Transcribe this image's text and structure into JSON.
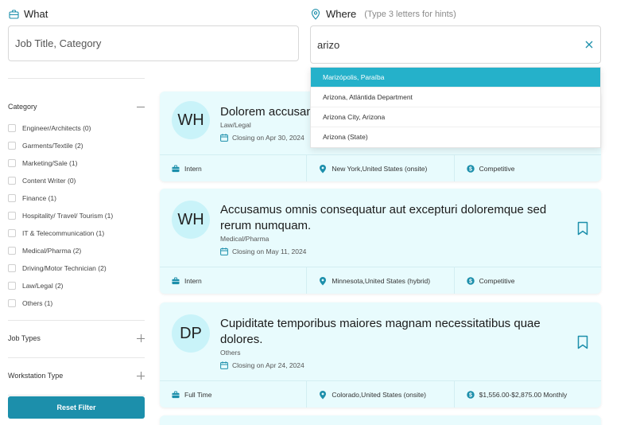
{
  "search": {
    "what_label": "What",
    "what_placeholder": "Job Title, Category",
    "where_label": "Where",
    "where_hint": "(Type 3 letters for hints)",
    "where_value": "arizo",
    "suggestions": [
      "Marizópolis, Paraíba",
      "Arizona, Atlántida Department",
      "Arizona City, Arizona",
      "Arizona (State)"
    ]
  },
  "sidebar": {
    "category_title": "Category",
    "categories": [
      "Engineer/Architects (0)",
      "Garments/Textile (2)",
      "Marketing/Sale (1)",
      "Content Writer (0)",
      "Finance (1)",
      "Hospitality/ Travel/ Tourism (1)",
      "IT & Telecommunication (1)",
      "Medical/Pharma (2)",
      "Driving/Motor Technician (2)",
      "Law/Legal (2)",
      "Others (1)"
    ],
    "job_types_title": "Job Types",
    "workstation_title": "Workstation Type",
    "reset_label": "Reset Filter"
  },
  "jobs": [
    {
      "initials": "WH",
      "title": "Dolorem accusan",
      "category": "Law/Legal",
      "closing": "Closing on Apr 30, 2024",
      "type": "Intern",
      "location": "New York,United States (onsite)",
      "salary": "Competitive"
    },
    {
      "initials": "WH",
      "title": "Accusamus omnis consequatur aut excepturi doloremque sed rerum numquam.",
      "category": "Medical/Pharma",
      "closing": "Closing on May 11, 2024",
      "type": "Intern",
      "location": "Minnesota,United States (hybrid)",
      "salary": "Competitive"
    },
    {
      "initials": "DP",
      "title": "Cupiditate temporibus maiores magnam necessitatibus quae dolores.",
      "category": "Others",
      "closing": "Closing on Apr 24, 2024",
      "type": "Full Time",
      "location": "Colorado,United States (onsite)",
      "salary": "$1,556.00-$2,875.00 Monthly"
    }
  ],
  "colors": {
    "accent": "#1c8fab",
    "highlight": "#25b1ca",
    "card_bg": "#e8fbfd",
    "avatar_bg": "#c9f3f9",
    "icon": "#1c8fab"
  },
  "icons": {
    "what": "briefcase-icon",
    "where": "map-pin-icon",
    "clear": "close-icon",
    "closing": "calendar-icon",
    "bookmark": "bookmark-icon",
    "type": "briefcase-icon",
    "location": "map-pin-icon",
    "salary": "dollar-icon"
  }
}
